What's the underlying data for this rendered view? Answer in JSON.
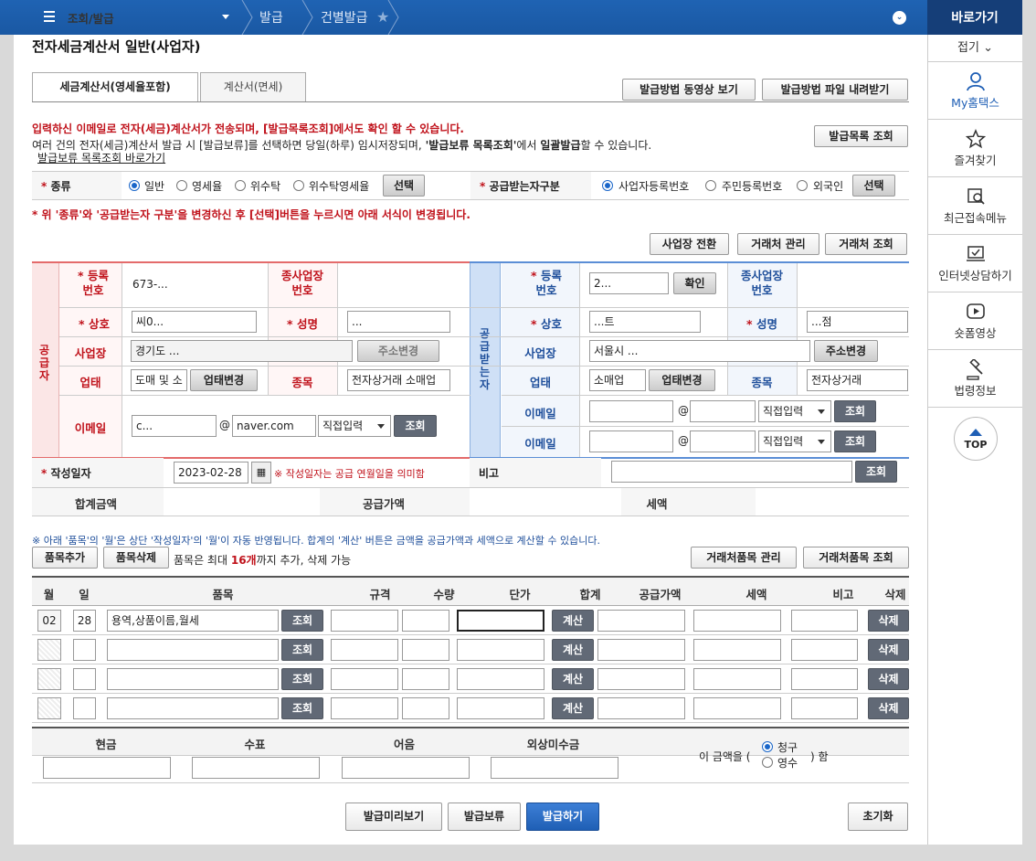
{
  "topbar": {
    "menu": "조회/발급",
    "crumb1": "발급",
    "crumb2": "건별발급",
    "quick": "바로가기"
  },
  "side": {
    "fold": "접기",
    "items": [
      "My홈택스",
      "즐겨찾기",
      "최근접속메뉴",
      "인터넷상담하기",
      "숏폼영상",
      "법령정보"
    ],
    "top": "TOP"
  },
  "page": {
    "title": "전자세금계산서 일반(사업자)"
  },
  "tabs": [
    "세금계산서(영세율포함)",
    "계산서(면세)"
  ],
  "buttons": {
    "video": "발급방법 동영상 보기",
    "file": "발급방법 파일 내려받기",
    "list": "발급목록 조회",
    "select": "선택",
    "switch": "사업장 전환",
    "client_mgmt": "거래처 관리",
    "client_query": "거래처 조회",
    "confirm": "확인",
    "addr_change": "주소변경",
    "biz_change": "업태변경",
    "query": "조회",
    "item_add": "품목추가",
    "item_del": "품목삭제",
    "client_item_mgmt": "거래처품목 관리",
    "client_item_query": "거래처품목 조회",
    "calc": "계산",
    "del": "삭제",
    "preview": "발급미리보기",
    "hold": "발급보류",
    "issue": "발급하기",
    "reset": "초기화"
  },
  "notice": {
    "line1": "입력하신 이메일로 전자(세금)계산서가 전송되며, [발급목록조회]에서도 확인 할 수 있습니다.",
    "line2a": "여러 건의 전자(세금)계산서 발급 시 [발급보류]를 선택하면 당일(하루) 임시저장되며, ",
    "line2b": "'발급보류 목록조회'",
    "line2c": "에서 ",
    "line2d": "일괄발급",
    "line2e": "할 수 있습니다.",
    "link": "발급보류 목록조회 바로가기",
    "warn": "* 위 '종류'와 '공급받는자 구분'을 변경하신 후 [선택]버튼을 누르시면 아래 서식이 변경됩니다."
  },
  "kind": {
    "label": "종류",
    "options": [
      "일반",
      "영세율",
      "위수탁",
      "위수탁영세율"
    ],
    "selected": "일반"
  },
  "receiver_type": {
    "label": "공급받는자구분",
    "options": [
      "사업자등록번호",
      "주민등록번호",
      "외국인"
    ],
    "selected": "사업자등록번호"
  },
  "supplier": {
    "side_label": "공급자",
    "reg_label": "등록\n번호",
    "reg": "673-...",
    "sub_label": "종사업장\n번호",
    "name_label": "상호",
    "name": "씨0...",
    "ceo_label": "성명",
    "ceo": "...",
    "addr_label": "사업장",
    "addr": "경기도 ...",
    "biz_label": "업태",
    "biz": "도매 및 소",
    "item_label": "종목",
    "item": "전자상거래 소매업",
    "email_label": "이메일",
    "email_id": "c...",
    "email_domain": "naver.com",
    "email_sel": "직접입력"
  },
  "receiver": {
    "side_label": "공급받는자",
    "reg_label": "등록\n번호",
    "reg": "2...",
    "sub_label": "종사업장\n번호",
    "name_label": "상호",
    "name": "...트",
    "ceo_label": "성명",
    "ceo": "...점",
    "addr_label": "사업장",
    "addr": "서울시 ...",
    "biz_label": "업태",
    "biz": "소매업",
    "item_label": "종목",
    "item": "전자상거래",
    "email_label": "이메일",
    "email_sel": "직접입력"
  },
  "date": {
    "label": "작성일자",
    "value": "2023-02-28",
    "note": "※ 작성일자는 공급 연월일을 의미함",
    "remark_label": "비고"
  },
  "totals": {
    "sum": "합계금액",
    "supply": "공급가액",
    "tax": "세액"
  },
  "items_notice": "※ 아래 '품목'의 '월'은 상단 '작성일자'의 '월'이 자동 반영됩니다. 합계의 '계산' 버튼은 금액을 공급가액과 세액으로 계산할 수 있습니다.",
  "items_limit": {
    "a": "품목은 최대 ",
    "b": "16개",
    "c": "까지 추가, 삭제 가능"
  },
  "items_header": [
    "월",
    "일",
    "품목",
    "규격",
    "수량",
    "단가",
    "합계",
    "공급가액",
    "세액",
    "비고",
    "삭제"
  ],
  "items_rows": [
    {
      "month": "02",
      "day": "28",
      "name": "용역,상품이름,월세"
    },
    {
      "month": "",
      "day": "",
      "name": ""
    },
    {
      "month": "",
      "day": "",
      "name": ""
    },
    {
      "month": "",
      "day": "",
      "name": ""
    }
  ],
  "pay": {
    "headers": [
      "현금",
      "수표",
      "어음",
      "외상미수금"
    ],
    "prefix": "이 금액을 (",
    "options": [
      "청구",
      "영수"
    ],
    "selected": "청구",
    "suffix": ") 함"
  }
}
